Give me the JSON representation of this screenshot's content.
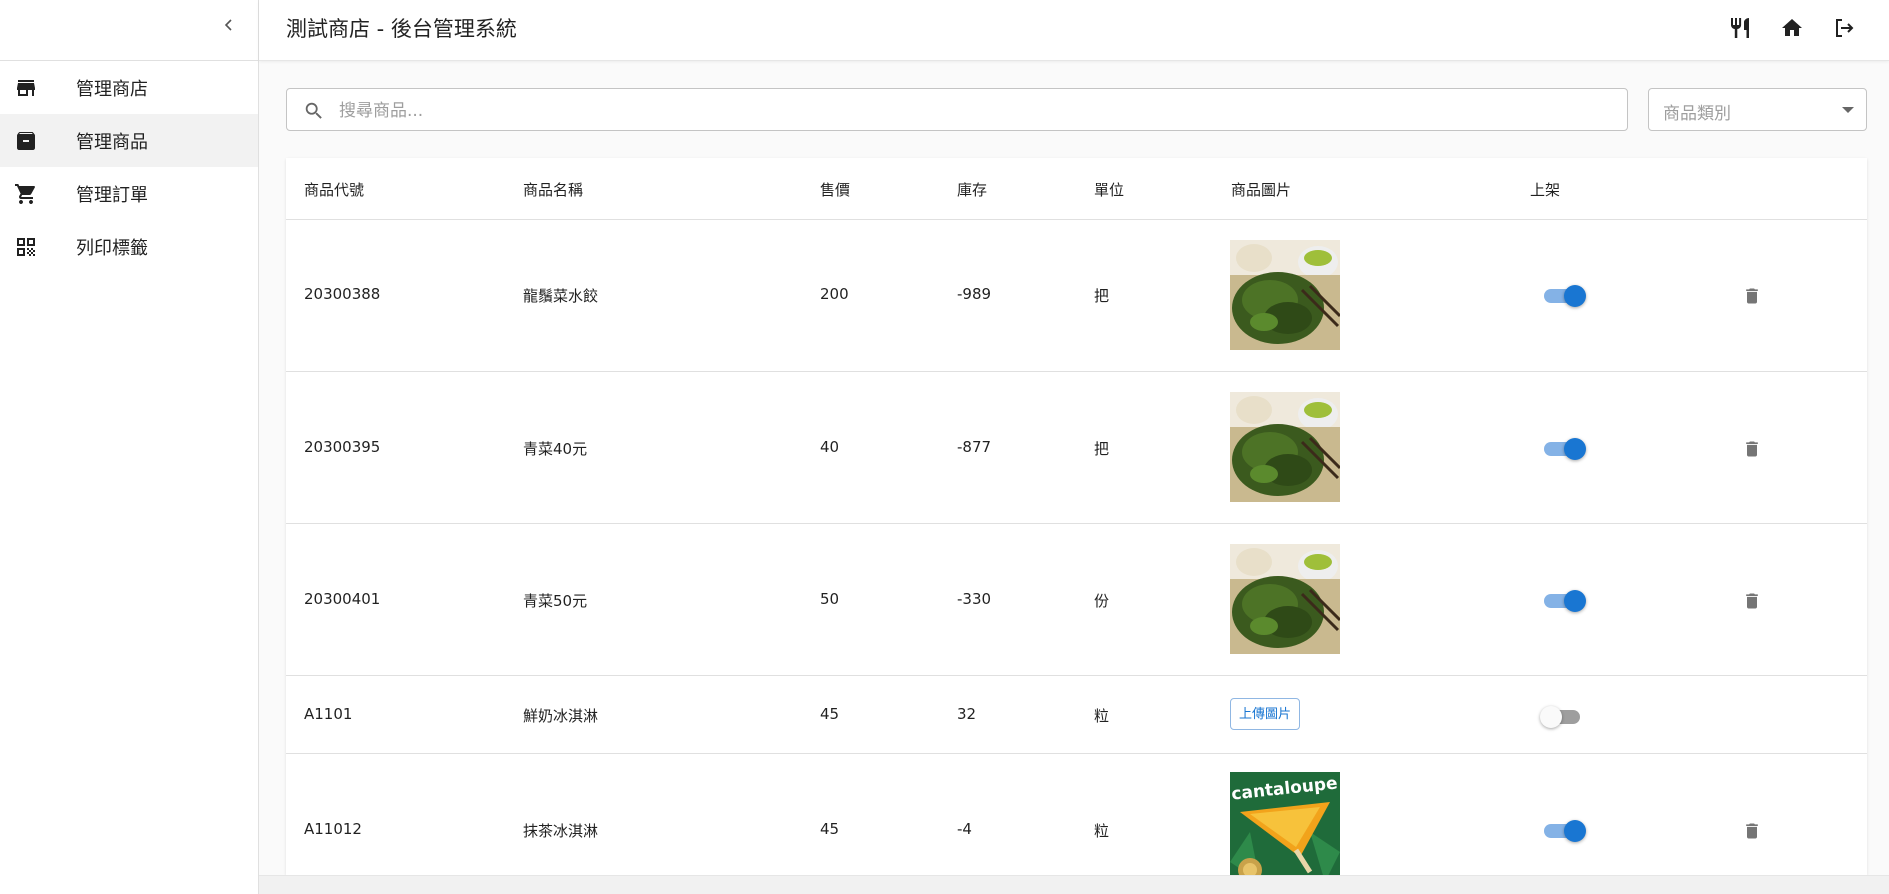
{
  "header": {
    "title": "測試商店 - 後台管理系統"
  },
  "sidebar": {
    "items": [
      {
        "label": "管理商店",
        "icon": "store-icon"
      },
      {
        "label": "管理商品",
        "icon": "archive-box-icon",
        "active": true
      },
      {
        "label": "管理訂單",
        "icon": "shopping-cart-icon"
      },
      {
        "label": "列印標籤",
        "icon": "qr-code-icon"
      }
    ]
  },
  "search": {
    "placeholder": "搜尋商品...",
    "category_placeholder": "商品類別"
  },
  "table": {
    "columns": [
      "商品代號",
      "商品名稱",
      "售價",
      "庫存",
      "單位",
      "商品圖片",
      "上架"
    ],
    "upload_label": "上傳圖片",
    "rows": [
      {
        "code": "20300388",
        "name": "龍鬚菜水餃",
        "price": "200",
        "stock": "-989",
        "unit": "把",
        "image": "greens",
        "listed": true
      },
      {
        "code": "20300395",
        "name": "青菜40元",
        "price": "40",
        "stock": "-877",
        "unit": "把",
        "image": "greens",
        "listed": true
      },
      {
        "code": "20300401",
        "name": "青菜50元",
        "price": "50",
        "stock": "-330",
        "unit": "份",
        "image": "greens",
        "listed": true
      },
      {
        "code": "A1101",
        "name": "鮮奶冰淇淋",
        "price": "45",
        "stock": "32",
        "unit": "粒",
        "image": "",
        "listed": false
      },
      {
        "code": "A11012",
        "name": "抹茶冰淇淋",
        "price": "45",
        "stock": "-4",
        "unit": "粒",
        "image": "cantaloupe",
        "listed": true
      }
    ],
    "cantaloupe_text": "cantaloupe"
  },
  "colors": {
    "primary": "#1976d2",
    "switch_track": "#84b2e6",
    "icon": "#212121",
    "delete_icon": "#757575"
  }
}
